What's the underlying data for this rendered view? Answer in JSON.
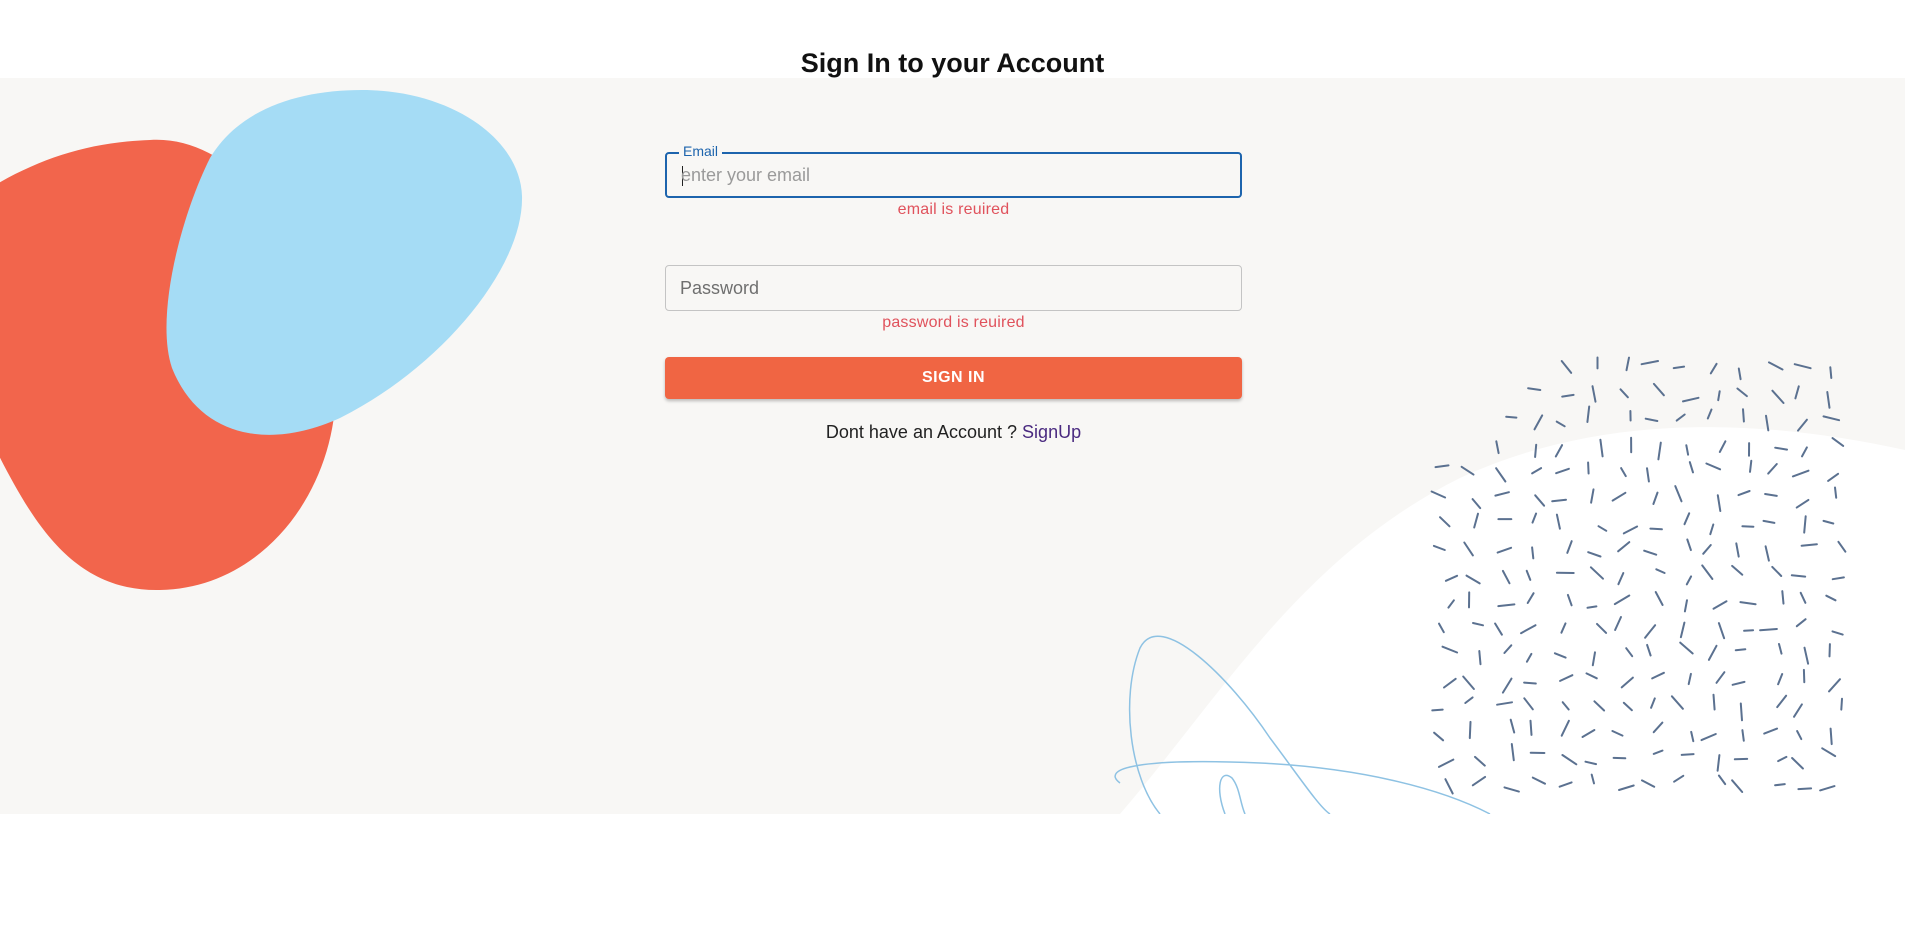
{
  "page": {
    "title": "Sign In to your Account"
  },
  "form": {
    "email": {
      "label": "Email",
      "placeholder": "enter your email",
      "value": "",
      "error": "email is reuired"
    },
    "password": {
      "placeholder": "Password",
      "value": "",
      "error": "password is reuired"
    },
    "submit_label": "SIGN IN",
    "signup_prompt": "Dont have an Account ?",
    "signup_link": "SignUp"
  },
  "colors": {
    "accent": "#f06543",
    "focus_blue": "#1d64ad",
    "error": "#e0525c",
    "link": "#4a2a80",
    "blob_red": "#f2654c",
    "blob_blue": "#a5dcf5",
    "background": "#f8f7f5",
    "dash_marks": "#5b7190"
  },
  "decorations": {
    "left_blobs": [
      "red-blob",
      "blue-blob"
    ],
    "right_pattern": [
      "white-wave",
      "dash-pattern",
      "squiggle-line"
    ]
  }
}
